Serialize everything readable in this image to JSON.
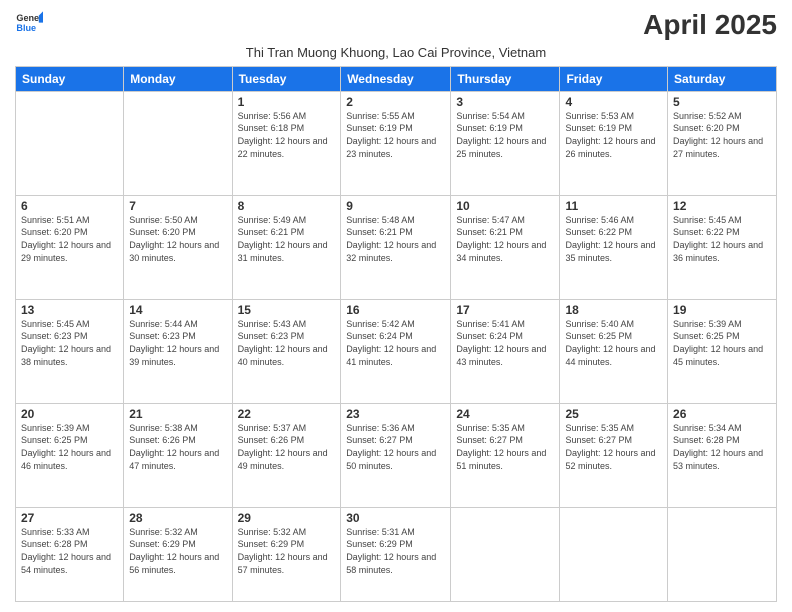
{
  "logo": {
    "line1": "General",
    "line2": "Blue"
  },
  "title": "April 2025",
  "subtitle": "Thi Tran Muong Khuong, Lao Cai Province, Vietnam",
  "days_of_week": [
    "Sunday",
    "Monday",
    "Tuesday",
    "Wednesday",
    "Thursday",
    "Friday",
    "Saturday"
  ],
  "weeks": [
    [
      {
        "day": "",
        "sunrise": "",
        "sunset": "",
        "daylight": ""
      },
      {
        "day": "",
        "sunrise": "",
        "sunset": "",
        "daylight": ""
      },
      {
        "day": "1",
        "sunrise": "Sunrise: 5:56 AM",
        "sunset": "Sunset: 6:18 PM",
        "daylight": "Daylight: 12 hours and 22 minutes."
      },
      {
        "day": "2",
        "sunrise": "Sunrise: 5:55 AM",
        "sunset": "Sunset: 6:19 PM",
        "daylight": "Daylight: 12 hours and 23 minutes."
      },
      {
        "day": "3",
        "sunrise": "Sunrise: 5:54 AM",
        "sunset": "Sunset: 6:19 PM",
        "daylight": "Daylight: 12 hours and 25 minutes."
      },
      {
        "day": "4",
        "sunrise": "Sunrise: 5:53 AM",
        "sunset": "Sunset: 6:19 PM",
        "daylight": "Daylight: 12 hours and 26 minutes."
      },
      {
        "day": "5",
        "sunrise": "Sunrise: 5:52 AM",
        "sunset": "Sunset: 6:20 PM",
        "daylight": "Daylight: 12 hours and 27 minutes."
      }
    ],
    [
      {
        "day": "6",
        "sunrise": "Sunrise: 5:51 AM",
        "sunset": "Sunset: 6:20 PM",
        "daylight": "Daylight: 12 hours and 29 minutes."
      },
      {
        "day": "7",
        "sunrise": "Sunrise: 5:50 AM",
        "sunset": "Sunset: 6:20 PM",
        "daylight": "Daylight: 12 hours and 30 minutes."
      },
      {
        "day": "8",
        "sunrise": "Sunrise: 5:49 AM",
        "sunset": "Sunset: 6:21 PM",
        "daylight": "Daylight: 12 hours and 31 minutes."
      },
      {
        "day": "9",
        "sunrise": "Sunrise: 5:48 AM",
        "sunset": "Sunset: 6:21 PM",
        "daylight": "Daylight: 12 hours and 32 minutes."
      },
      {
        "day": "10",
        "sunrise": "Sunrise: 5:47 AM",
        "sunset": "Sunset: 6:21 PM",
        "daylight": "Daylight: 12 hours and 34 minutes."
      },
      {
        "day": "11",
        "sunrise": "Sunrise: 5:46 AM",
        "sunset": "Sunset: 6:22 PM",
        "daylight": "Daylight: 12 hours and 35 minutes."
      },
      {
        "day": "12",
        "sunrise": "Sunrise: 5:45 AM",
        "sunset": "Sunset: 6:22 PM",
        "daylight": "Daylight: 12 hours and 36 minutes."
      }
    ],
    [
      {
        "day": "13",
        "sunrise": "Sunrise: 5:45 AM",
        "sunset": "Sunset: 6:23 PM",
        "daylight": "Daylight: 12 hours and 38 minutes."
      },
      {
        "day": "14",
        "sunrise": "Sunrise: 5:44 AM",
        "sunset": "Sunset: 6:23 PM",
        "daylight": "Daylight: 12 hours and 39 minutes."
      },
      {
        "day": "15",
        "sunrise": "Sunrise: 5:43 AM",
        "sunset": "Sunset: 6:23 PM",
        "daylight": "Daylight: 12 hours and 40 minutes."
      },
      {
        "day": "16",
        "sunrise": "Sunrise: 5:42 AM",
        "sunset": "Sunset: 6:24 PM",
        "daylight": "Daylight: 12 hours and 41 minutes."
      },
      {
        "day": "17",
        "sunrise": "Sunrise: 5:41 AM",
        "sunset": "Sunset: 6:24 PM",
        "daylight": "Daylight: 12 hours and 43 minutes."
      },
      {
        "day": "18",
        "sunrise": "Sunrise: 5:40 AM",
        "sunset": "Sunset: 6:25 PM",
        "daylight": "Daylight: 12 hours and 44 minutes."
      },
      {
        "day": "19",
        "sunrise": "Sunrise: 5:39 AM",
        "sunset": "Sunset: 6:25 PM",
        "daylight": "Daylight: 12 hours and 45 minutes."
      }
    ],
    [
      {
        "day": "20",
        "sunrise": "Sunrise: 5:39 AM",
        "sunset": "Sunset: 6:25 PM",
        "daylight": "Daylight: 12 hours and 46 minutes."
      },
      {
        "day": "21",
        "sunrise": "Sunrise: 5:38 AM",
        "sunset": "Sunset: 6:26 PM",
        "daylight": "Daylight: 12 hours and 47 minutes."
      },
      {
        "day": "22",
        "sunrise": "Sunrise: 5:37 AM",
        "sunset": "Sunset: 6:26 PM",
        "daylight": "Daylight: 12 hours and 49 minutes."
      },
      {
        "day": "23",
        "sunrise": "Sunrise: 5:36 AM",
        "sunset": "Sunset: 6:27 PM",
        "daylight": "Daylight: 12 hours and 50 minutes."
      },
      {
        "day": "24",
        "sunrise": "Sunrise: 5:35 AM",
        "sunset": "Sunset: 6:27 PM",
        "daylight": "Daylight: 12 hours and 51 minutes."
      },
      {
        "day": "25",
        "sunrise": "Sunrise: 5:35 AM",
        "sunset": "Sunset: 6:27 PM",
        "daylight": "Daylight: 12 hours and 52 minutes."
      },
      {
        "day": "26",
        "sunrise": "Sunrise: 5:34 AM",
        "sunset": "Sunset: 6:28 PM",
        "daylight": "Daylight: 12 hours and 53 minutes."
      }
    ],
    [
      {
        "day": "27",
        "sunrise": "Sunrise: 5:33 AM",
        "sunset": "Sunset: 6:28 PM",
        "daylight": "Daylight: 12 hours and 54 minutes."
      },
      {
        "day": "28",
        "sunrise": "Sunrise: 5:32 AM",
        "sunset": "Sunset: 6:29 PM",
        "daylight": "Daylight: 12 hours and 56 minutes."
      },
      {
        "day": "29",
        "sunrise": "Sunrise: 5:32 AM",
        "sunset": "Sunset: 6:29 PM",
        "daylight": "Daylight: 12 hours and 57 minutes."
      },
      {
        "day": "30",
        "sunrise": "Sunrise: 5:31 AM",
        "sunset": "Sunset: 6:29 PM",
        "daylight": "Daylight: 12 hours and 58 minutes."
      },
      {
        "day": "",
        "sunrise": "",
        "sunset": "",
        "daylight": ""
      },
      {
        "day": "",
        "sunrise": "",
        "sunset": "",
        "daylight": ""
      },
      {
        "day": "",
        "sunrise": "",
        "sunset": "",
        "daylight": ""
      }
    ]
  ]
}
